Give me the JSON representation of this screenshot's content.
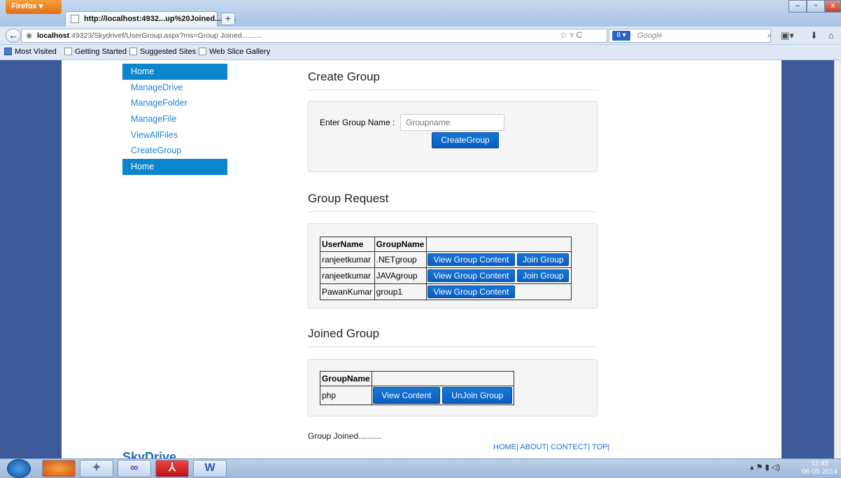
{
  "browser": {
    "app_button": "Firefox ▾",
    "tab_title": "http://localhost:4932...up%20Joined..........",
    "new_tab": "+",
    "url_host": "localhost",
    "url_rest": ":49323/Skydrivef/UserGroup.aspx?ms=Group Joined..........",
    "search_engine": "8 ▾",
    "search_placeholder": "Google",
    "bookmarks": [
      "Most Visited",
      "Getting Started",
      "Suggested Sites",
      "Web Slice Gallery"
    ]
  },
  "menu": {
    "items": [
      {
        "label": "Home"
      },
      {
        "label": "ManageDrive"
      },
      {
        "label": "ManageFolder"
      },
      {
        "label": "ManageFile"
      },
      {
        "label": "ViewAllFiles"
      },
      {
        "label": "CreateGroup"
      },
      {
        "label": "Home"
      }
    ]
  },
  "create_group": {
    "heading": "Create Group",
    "field_label": "Enter Group Name :",
    "field_placeholder": "Groupname",
    "button": "CreateGroup"
  },
  "group_request": {
    "heading": "Group Request",
    "columns": [
      "UserName",
      "GroupName"
    ],
    "rows": [
      {
        "user": "ranjeetkumar",
        "group": ".NETgroup",
        "view": "View Group Content",
        "join": "Join Group"
      },
      {
        "user": "ranjeetkumar",
        "group": "JAVAgroup",
        "view": "View Group Content",
        "join": "Join Group"
      },
      {
        "user": "PawanKumar",
        "group": "group1",
        "view": "View Group Content",
        "join": ""
      }
    ]
  },
  "joined_group": {
    "heading": "Joined Group",
    "column": "GroupName",
    "rows": [
      {
        "group": "php",
        "view": "View Content",
        "unjoin": "UnJoin Group"
      }
    ]
  },
  "status_message": "Group Joined..........",
  "footer": "HOME| ABOUT| CONTECT| TOP|",
  "logo_text": "SkyDrive",
  "clock": {
    "time": "12:45",
    "date": "06-05-2014"
  }
}
